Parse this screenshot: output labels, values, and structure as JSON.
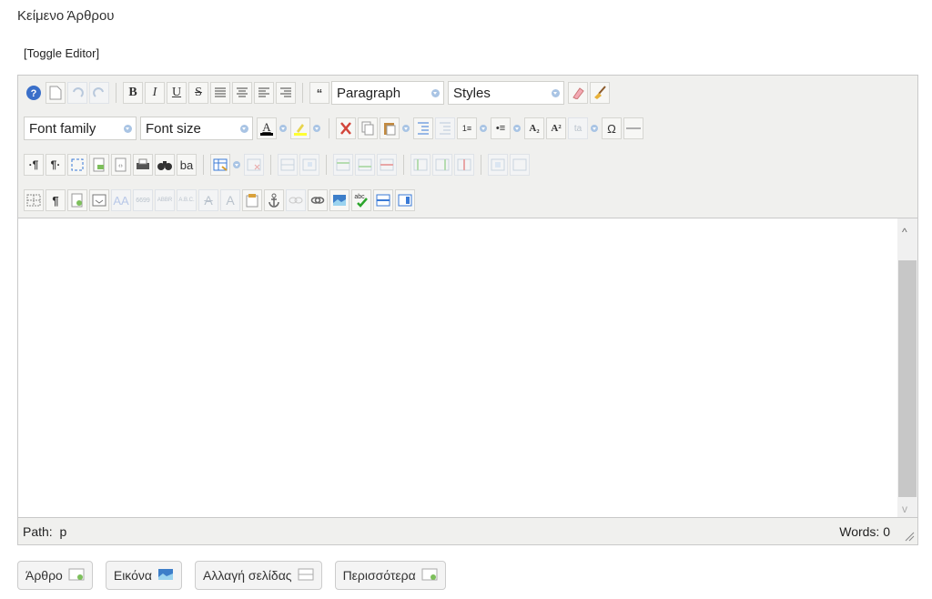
{
  "field_label": "Κείμενο Άρθρου",
  "toggle_label": "[Toggle Editor]",
  "toolbar": {
    "format_select": "Paragraph",
    "styles_select": "Styles",
    "font_family_select": "Font family",
    "font_size_select": "Font size",
    "bold": "B",
    "italic": "I",
    "underline": "U",
    "strike": "S",
    "subscript": "A₂",
    "superscript": "A²",
    "special_char": "Ω",
    "show_blocks_left": "·¶",
    "show_blocks_right": "¶·",
    "visual_chars": "¶",
    "replace": "ba",
    "cite": "6699",
    "abbr": "ABBR",
    "acronym": "A.B.C."
  },
  "status": {
    "path_label": "Path:",
    "path_value": "p",
    "words": "Words: 0"
  },
  "buttons": [
    {
      "label": "Άρθρο",
      "icon": "article-icon"
    },
    {
      "label": "Εικόνα",
      "icon": "image-icon"
    },
    {
      "label": "Αλλαγή σελίδας",
      "icon": "pagebreak-icon"
    },
    {
      "label": "Περισσότερα",
      "icon": "readmore-icon"
    }
  ]
}
